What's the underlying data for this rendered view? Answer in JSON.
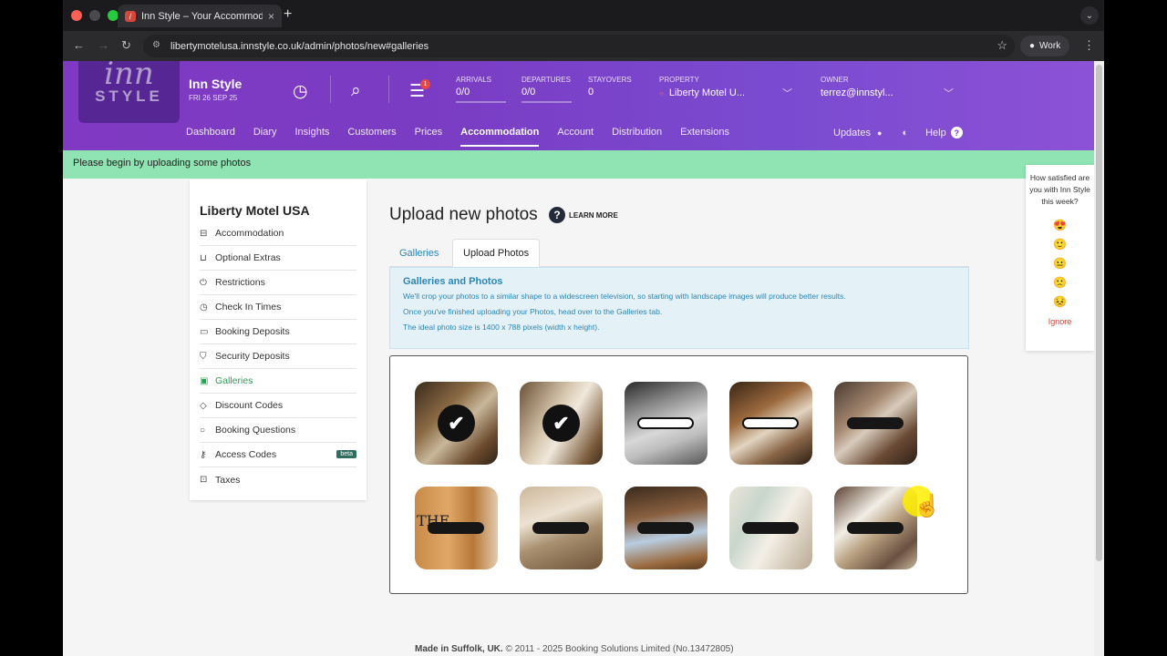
{
  "browser": {
    "tab_title": "Inn Style – Your Accommodati",
    "tab_favicon": "/",
    "close_glyph": "×",
    "new_tab_glyph": "+",
    "url": "libertymotelusa.innstyle.co.uk/admin/photos/new#galleries",
    "profile": "Work",
    "colors": {
      "close": "#ff5f57",
      "minimize": "#4a4a4e",
      "maximize": "#28c840"
    }
  },
  "header": {
    "logo_top": "inn",
    "logo_bottom": "STYLE",
    "brand": "Inn Style",
    "date": "FRI 26 SEP 25",
    "notification_count": "1",
    "arrivals_label": "ARRIVALS",
    "arrivals_value": "0/0",
    "departures_label": "DEPARTURES",
    "departures_value": "0/0",
    "stayovers_label": "STAYOVERS",
    "stayovers_value": "0",
    "property_label": "PROPERTY",
    "property_value": "Liberty Motel U...",
    "owner_label": "OWNER",
    "owner_value": "terrez@innstyl...",
    "accent": "#7a3cc3"
  },
  "nav": {
    "items": [
      "Dashboard",
      "Diary",
      "Insights",
      "Customers",
      "Prices",
      "Accommodation",
      "Account",
      "Distribution",
      "Extensions"
    ],
    "active": "Accommodation",
    "updates": "Updates",
    "help": "Help"
  },
  "flash": "Please begin by uploading some photos",
  "sidebar": {
    "title": "Liberty Motel USA",
    "items": [
      {
        "label": "Accommodation",
        "icon": "bed-icon"
      },
      {
        "label": "Optional Extras",
        "icon": "cart-icon"
      },
      {
        "label": "Restrictions",
        "icon": "power-icon"
      },
      {
        "label": "Check In Times",
        "icon": "clock-icon"
      },
      {
        "label": "Booking Deposits",
        "icon": "card-icon"
      },
      {
        "label": "Security Deposits",
        "icon": "shield-icon"
      },
      {
        "label": "Galleries",
        "icon": "image-icon"
      },
      {
        "label": "Discount Codes",
        "icon": "tag-icon"
      },
      {
        "label": "Booking Questions",
        "icon": "chat-icon"
      },
      {
        "label": "Access Codes",
        "icon": "key-icon"
      },
      {
        "label": "Taxes",
        "icon": "briefcase-icon"
      }
    ],
    "active": "Galleries",
    "beta": "beta",
    "active_color": "#2b9e55"
  },
  "main": {
    "title": "Upload new photos",
    "learn_more": "LEARN MORE",
    "tabs": [
      "Galleries",
      "Upload Photos"
    ],
    "active_tab": "Upload Photos",
    "info_heading": "Galleries and Photos",
    "info_lines": [
      "We'll crop your photos to a similar shape to a widescreen television, so starting with landscape images will produce better results.",
      "Once you've finished uploading your Photos, head over to the Galleries tab.",
      "The ideal photo size is 1400 x 788 pixels (width x height)."
    ],
    "photo_sign_text": "THE",
    "photos": [
      {
        "state": "selected"
      },
      {
        "state": "selected"
      },
      {
        "state": "uploading"
      },
      {
        "state": "uploading"
      },
      {
        "state": "pending"
      },
      {
        "state": "pending"
      },
      {
        "state": "pending"
      },
      {
        "state": "pending"
      },
      {
        "state": "pending"
      },
      {
        "state": "pending"
      }
    ]
  },
  "footer": {
    "bold": "Made in Suffolk, UK.",
    "rest": " © 2011 - 2025 Booking Solutions Limited (No.13472805)"
  },
  "survey": {
    "question": "How satisfied are you with Inn Style this week?",
    "faces": [
      "😍",
      "🙂",
      "😐",
      "🙁",
      "😣"
    ],
    "ignore": "Ignore"
  }
}
